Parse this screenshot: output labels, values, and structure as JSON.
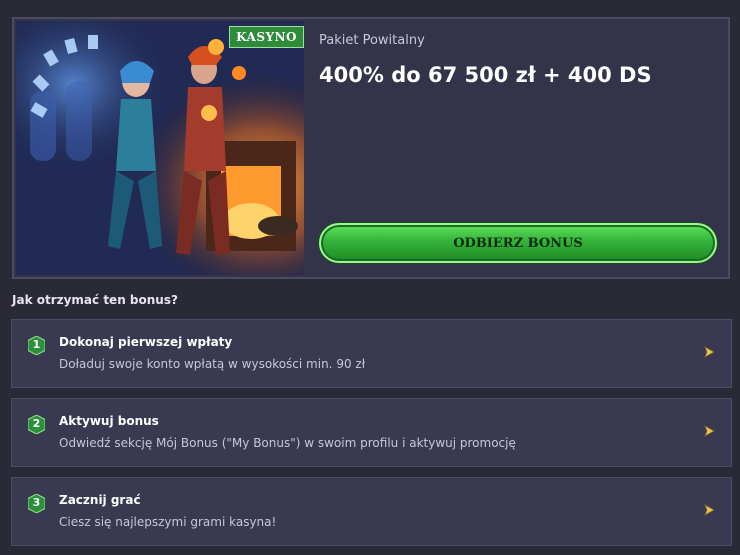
{
  "promo": {
    "badge": "KASYNO",
    "subtitle": "Pakiet Powitalny",
    "title": "400% do 67 500 zł + 400 DS",
    "cta_label": "ODBIERZ BONUS"
  },
  "how_to": {
    "heading": "Jak otrzymać ten bonus?",
    "steps": [
      {
        "number": "1",
        "title": "Dokonaj pierwszej wpłaty",
        "description": "Doładuj swoje konto wpłatą w wysokości min. 90 zł"
      },
      {
        "number": "2",
        "title": "Aktywuj bonus",
        "description": "Odwiedź sekcję Mój Bonus (\"My Bonus\") w swoim profilu i aktywuj promocję"
      },
      {
        "number": "3",
        "title": "Zacznij grać",
        "description": "Ciesz się najlepszymi grami kasyna!"
      }
    ]
  },
  "icons": {
    "step_badge": "hexagon-number-icon",
    "chevron": "chevron-right-icon"
  },
  "colors": {
    "background": "#2a2a36",
    "card": "#33344a",
    "cta_green": "#34b33a",
    "badge_green": "#2e8b3a",
    "arrow_gold": "#e8c45a"
  }
}
